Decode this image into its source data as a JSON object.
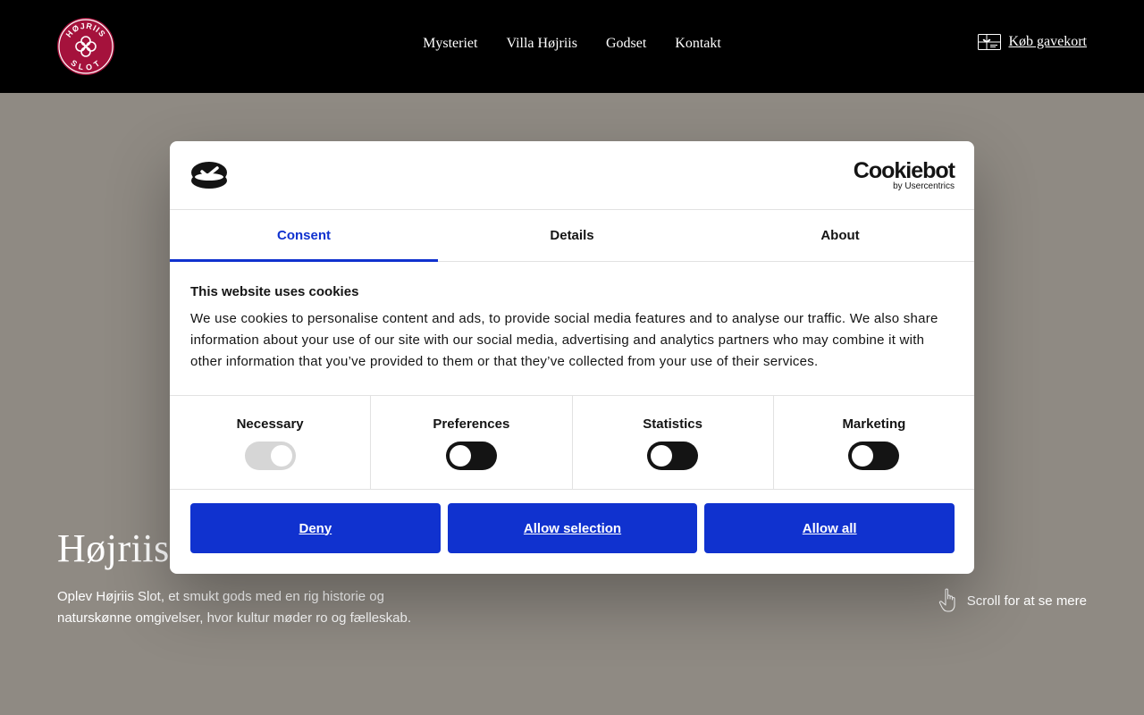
{
  "header": {
    "logo": {
      "icon": "hojriis-slot-logo",
      "text_top": "HØJRIIS",
      "text_bottom": "SLOT",
      "color": "#a5123c"
    },
    "nav": [
      {
        "label": "Mysteriet"
      },
      {
        "label": "Villa Højriis"
      },
      {
        "label": "Godset"
      },
      {
        "label": "Kontakt"
      }
    ],
    "giftcard": {
      "label": "Køb gavekort",
      "icon": "giftcard-icon"
    }
  },
  "hero": {
    "title": "Højriis",
    "text": "Oplev Højriis Slot, et smukt gods med en rig historie og naturskønne omgivelser, hvor kultur møder ro og fælleskab.",
    "scroll_label": "Scroll for at se mere",
    "scroll_icon": "hand-pointer-icon",
    "background": "#8f8a83"
  },
  "cookie_dialog": {
    "brand": {
      "name": "Cookiebot",
      "sub": "by Usercentrics"
    },
    "tabs": [
      {
        "label": "Consent",
        "active": true
      },
      {
        "label": "Details",
        "active": false
      },
      {
        "label": "About",
        "active": false
      }
    ],
    "title": "This website uses cookies",
    "description": "We use cookies to personalise content and ads, to provide social media features and to analyse our traffic. We also share information about your use of our site with our social media, advertising and analytics partners who may combine it with other information that you’ve provided to them or that they’ve collected from your use of their services.",
    "toggles": [
      {
        "label": "Necessary",
        "checked": true,
        "disabled": true
      },
      {
        "label": "Preferences",
        "checked": false,
        "disabled": false
      },
      {
        "label": "Statistics",
        "checked": false,
        "disabled": false
      },
      {
        "label": "Marketing",
        "checked": false,
        "disabled": false
      }
    ],
    "buttons": {
      "deny": "Deny",
      "allow_selection": "Allow selection",
      "allow_all": "Allow all"
    },
    "accent_color": "#1032cf"
  }
}
